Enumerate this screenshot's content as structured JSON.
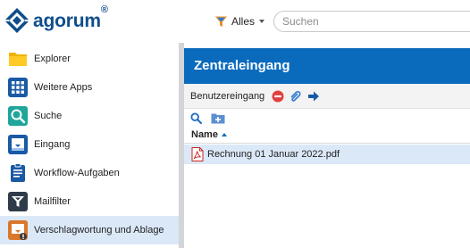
{
  "app": {
    "logo_text": "agorum",
    "logo_mark": "®"
  },
  "header": {
    "filter_label": "Alles",
    "search_placeholder": "Suchen"
  },
  "nav": {
    "items": [
      {
        "label": "Explorer",
        "icon": "folder-icon"
      },
      {
        "label": "Weitere Apps",
        "icon": "apps-grid-icon"
      },
      {
        "label": "Suche",
        "icon": "search-icon"
      },
      {
        "label": "Eingang",
        "icon": "inbox-icon"
      },
      {
        "label": "Workflow-Aufgaben",
        "icon": "clipboard-icon"
      },
      {
        "label": "Mailfilter",
        "icon": "mailfilter-icon"
      },
      {
        "label": "Verschlagwortung und Ablage",
        "icon": "tagging-icon",
        "active": true
      }
    ]
  },
  "panel": {
    "title": "Zentraleingang",
    "breadcrumb": "Benutzereingang",
    "column_name": "Name",
    "files": [
      {
        "name": "Rechnung 01 Januar 2022.pdf",
        "type": "pdf"
      }
    ]
  },
  "colors": {
    "brand": "#0f4e8c",
    "header_blue": "#0a6bbd",
    "selection": "#dbe8f8",
    "stop_red": "#e0403f"
  }
}
